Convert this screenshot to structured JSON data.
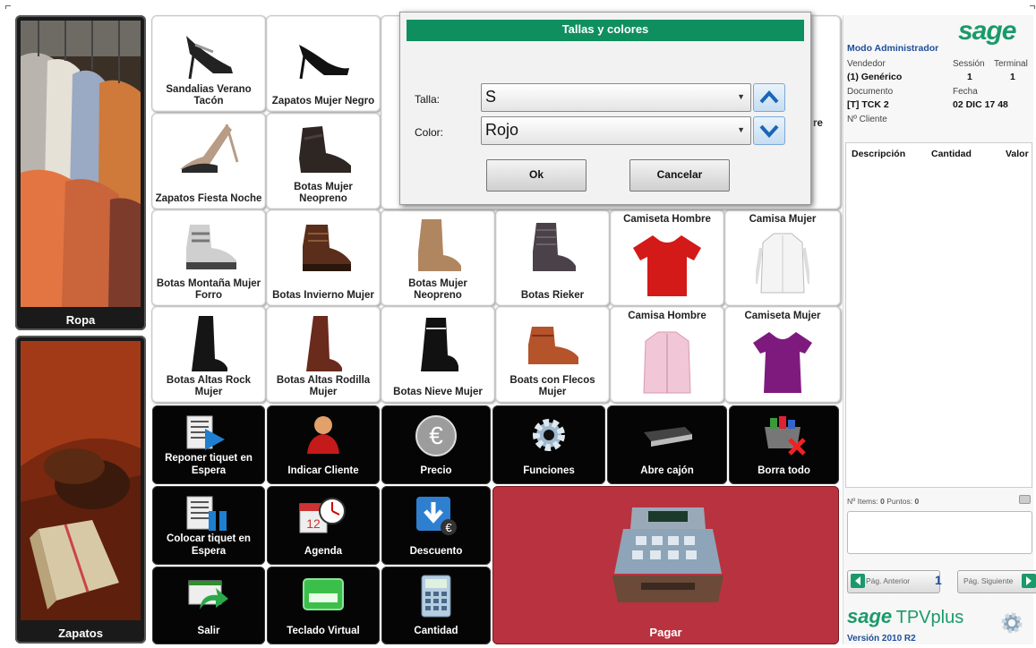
{
  "categories": [
    {
      "label": "Ropa"
    },
    {
      "label": "Zapatos"
    }
  ],
  "products": [
    {
      "name": "Sandalias Verano Tacón",
      "icon": "heeled-sandal-icon"
    },
    {
      "name": "Zapatos Mujer Negro",
      "icon": "black-pump-icon"
    },
    {
      "name": "Zapatos Fiesta Noche",
      "icon": "party-heel-icon"
    },
    {
      "name": "Botas Mujer Neopreno",
      "icon": "ankle-boot-icon"
    },
    {
      "name": "Botas Montaña Mujer Forro",
      "icon": "hiking-boot-icon"
    },
    {
      "name": "Botas Invierno Mujer",
      "icon": "winter-boot-icon"
    },
    {
      "name": "Botas Mujer Neopreno",
      "icon": "sheepskin-boot-icon"
    },
    {
      "name": "Botas Rieker",
      "icon": "knit-boot-icon"
    },
    {
      "name": "Camiseta Hombre",
      "icon": "red-tshirt-icon"
    },
    {
      "name": "Camisa Mujer",
      "icon": "white-blouse-icon"
    },
    {
      "name": "Botas Altas Rock Mujer",
      "icon": "tall-black-boot-icon"
    },
    {
      "name": "Botas Altas Rodilla Mujer",
      "icon": "knee-boot-icon"
    },
    {
      "name": "Botas Nieve Mujer",
      "icon": "snow-boot-icon"
    },
    {
      "name": "Boats con Flecos Mujer",
      "icon": "fringe-boot-icon"
    },
    {
      "name": "Camisa Hombre",
      "icon": "pink-shirt-icon"
    },
    {
      "name": "Camiseta Mujer",
      "icon": "purple-tshirt-icon"
    }
  ],
  "hidden_tile_fragment": "re",
  "actions": {
    "reponer": "Reponer tiquet en Espera",
    "indicar_cliente": "Indicar Cliente",
    "precio": "Precio",
    "funciones": "Funciones",
    "abre_cajon": "Abre cajón",
    "borra_todo": "Borra todo",
    "colocar": "Colocar tiquet en Espera",
    "agenda": "Agenda",
    "descuento": "Descuento",
    "pagar": "Pagar",
    "salir": "Salir",
    "teclado": "Teclado Virtual",
    "cantidad": "Cantidad"
  },
  "dialog": {
    "title": "Tallas y colores",
    "talla_label": "Talla:",
    "talla_value": "S",
    "color_label": "Color:",
    "color_value": "Rojo",
    "ok": "Ok",
    "cancel": "Cancelar"
  },
  "right_panel": {
    "logo": "sage",
    "mode": "Modo Administrador",
    "vendedor_label": "Vendedor",
    "vendedor_value": "(1) Genérico",
    "session_label": "Sessión",
    "session_value": "1",
    "terminal_label": "Terminal",
    "terminal_value": "1",
    "documento_label": "Documento",
    "documento_value": "[T] TCK 2",
    "fecha_label": "Fecha",
    "fecha_value": "02 DIC 17 48",
    "cliente_label": "Nº Cliente",
    "col_desc": "Descripción",
    "col_cant": "Cantidad",
    "col_valor": "Valor",
    "items_label": "Nº Items:",
    "items_value": "0",
    "puntos_label": "Puntos:",
    "puntos_value": "0",
    "prev_page": "Pág. Anterior",
    "page_number": "1",
    "next_page": "Pág. Siguiente",
    "brand_sage": "sage",
    "brand_product": "TPVplus",
    "version": "Versión 2010 R2"
  },
  "colors": {
    "dialog_header": "#0f8f5f",
    "pay_button": "#b8333f",
    "sage_green": "#1a9a6a",
    "accent_blue": "#1f4e9a"
  }
}
